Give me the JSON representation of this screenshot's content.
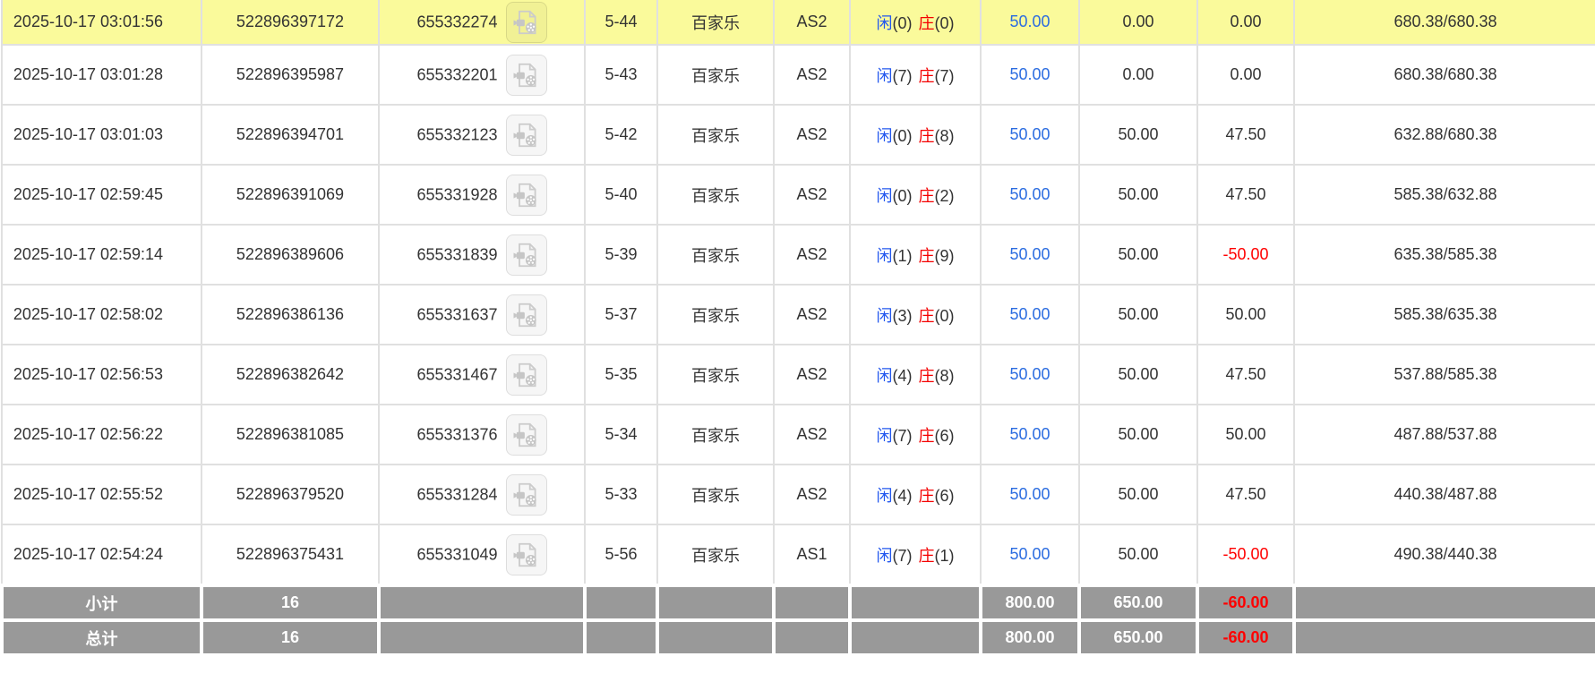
{
  "table": {
    "result_labels": {
      "player": "闲",
      "banker": "庄"
    },
    "icons": {
      "video": "video-camera-icon"
    },
    "colors": {
      "highlight_row": "#fafa9b",
      "summary_bg": "#999999",
      "summary_text": "#ffffff",
      "link_blue": "#2b6ce0",
      "player_blue": "#2257ee",
      "banker_red": "#f40000",
      "negative_red": "#ff0000",
      "text": "#333333",
      "row_border": "#e0e0e0"
    },
    "rows": [
      {
        "time": "2025-10-17 03:01:56",
        "order_no": "522896397172",
        "round_no": "655332274",
        "table_round": "5-44",
        "game": "百家乐",
        "table_code": "AS2",
        "player_result": "(0)",
        "banker_result": "(0)",
        "bet": "50.00",
        "valid": "0.00",
        "win_loss": "0.00",
        "balance": "680.38/680.38",
        "highlighted": true
      },
      {
        "time": "2025-10-17 03:01:28",
        "order_no": "522896395987",
        "round_no": "655332201",
        "table_round": "5-43",
        "game": "百家乐",
        "table_code": "AS2",
        "player_result": "(7)",
        "banker_result": "(7)",
        "bet": "50.00",
        "valid": "0.00",
        "win_loss": "0.00",
        "balance": "680.38/680.38",
        "highlighted": false
      },
      {
        "time": "2025-10-17 03:01:03",
        "order_no": "522896394701",
        "round_no": "655332123",
        "table_round": "5-42",
        "game": "百家乐",
        "table_code": "AS2",
        "player_result": "(0)",
        "banker_result": "(8)",
        "bet": "50.00",
        "valid": "50.00",
        "win_loss": "47.50",
        "balance": "632.88/680.38",
        "highlighted": false
      },
      {
        "time": "2025-10-17 02:59:45",
        "order_no": "522896391069",
        "round_no": "655331928",
        "table_round": "5-40",
        "game": "百家乐",
        "table_code": "AS2",
        "player_result": "(0)",
        "banker_result": "(2)",
        "bet": "50.00",
        "valid": "50.00",
        "win_loss": "47.50",
        "balance": "585.38/632.88",
        "highlighted": false
      },
      {
        "time": "2025-10-17 02:59:14",
        "order_no": "522896389606",
        "round_no": "655331839",
        "table_round": "5-39",
        "game": "百家乐",
        "table_code": "AS2",
        "player_result": "(1)",
        "banker_result": "(9)",
        "bet": "50.00",
        "valid": "50.00",
        "win_loss": "-50.00",
        "balance": "635.38/585.38",
        "highlighted": false
      },
      {
        "time": "2025-10-17 02:58:02",
        "order_no": "522896386136",
        "round_no": "655331637",
        "table_round": "5-37",
        "game": "百家乐",
        "table_code": "AS2",
        "player_result": "(3)",
        "banker_result": "(0)",
        "bet": "50.00",
        "valid": "50.00",
        "win_loss": "50.00",
        "balance": "585.38/635.38",
        "highlighted": false
      },
      {
        "time": "2025-10-17 02:56:53",
        "order_no": "522896382642",
        "round_no": "655331467",
        "table_round": "5-35",
        "game": "百家乐",
        "table_code": "AS2",
        "player_result": "(4)",
        "banker_result": "(8)",
        "bet": "50.00",
        "valid": "50.00",
        "win_loss": "47.50",
        "balance": "537.88/585.38",
        "highlighted": false
      },
      {
        "time": "2025-10-17 02:56:22",
        "order_no": "522896381085",
        "round_no": "655331376",
        "table_round": "5-34",
        "game": "百家乐",
        "table_code": "AS2",
        "player_result": "(7)",
        "banker_result": "(6)",
        "bet": "50.00",
        "valid": "50.00",
        "win_loss": "50.00",
        "balance": "487.88/537.88",
        "highlighted": false
      },
      {
        "time": "2025-10-17 02:55:52",
        "order_no": "522896379520",
        "round_no": "655331284",
        "table_round": "5-33",
        "game": "百家乐",
        "table_code": "AS2",
        "player_result": "(4)",
        "banker_result": "(6)",
        "bet": "50.00",
        "valid": "50.00",
        "win_loss": "47.50",
        "balance": "440.38/487.88",
        "highlighted": false
      },
      {
        "time": "2025-10-17 02:54:24",
        "order_no": "522896375431",
        "round_no": "655331049",
        "table_round": "5-56",
        "game": "百家乐",
        "table_code": "AS1",
        "player_result": "(7)",
        "banker_result": "(1)",
        "bet": "50.00",
        "valid": "50.00",
        "win_loss": "-50.00",
        "balance": "490.38/440.38",
        "highlighted": false
      }
    ],
    "summary_rows": [
      {
        "label": "小计",
        "count": "16",
        "bet": "800.00",
        "valid": "650.00",
        "win_loss": "-60.00"
      },
      {
        "label": "总计",
        "count": "16",
        "bet": "800.00",
        "valid": "650.00",
        "win_loss": "-60.00"
      }
    ]
  }
}
